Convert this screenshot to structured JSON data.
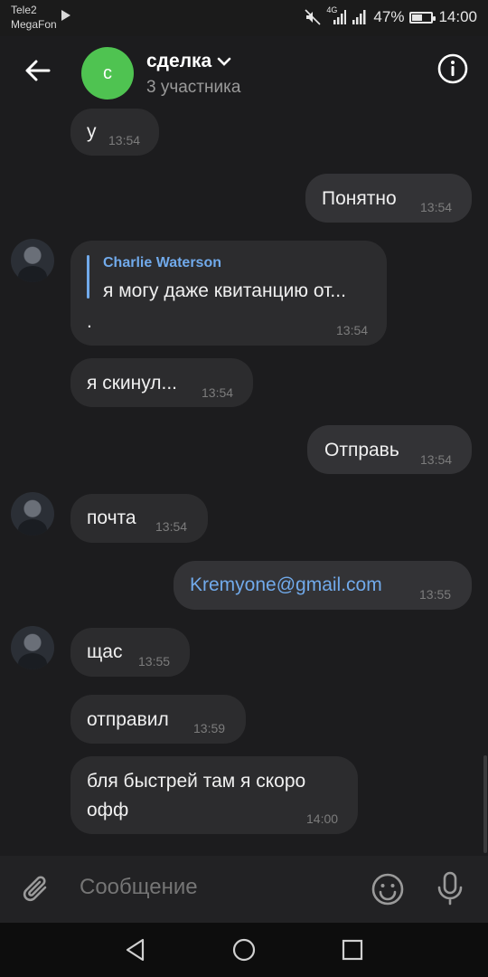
{
  "status_bar": {
    "carrier1": "Tele2",
    "carrier2": "MegaFon",
    "network": "4G",
    "battery_percent": "47%",
    "battery_level": 0.47,
    "clock": "14:00"
  },
  "header": {
    "avatar_letter": "с",
    "title": "сделка",
    "subtitle": "3 участника",
    "avatar_color": "#4fc351"
  },
  "messages": [
    {
      "dir": "in",
      "text": "у",
      "time": "13:54"
    },
    {
      "dir": "out",
      "text": "Понятно",
      "time": "13:54"
    },
    {
      "dir": "in",
      "reply_author": "Charlie Waterson",
      "text": "я могу даже квитанцию от...",
      "text2": ".",
      "time": "13:54"
    },
    {
      "dir": "in",
      "text": "я скинул...",
      "time": "13:54"
    },
    {
      "dir": "out",
      "text": "Отправь",
      "time": "13:54"
    },
    {
      "dir": "in",
      "text": "почта",
      "time": "13:54"
    },
    {
      "dir": "out",
      "text": "Kremyone@gmail.com",
      "time": "13:55",
      "is_link": true
    },
    {
      "dir": "in",
      "text": "щас",
      "time": "13:55"
    },
    {
      "dir": "in",
      "text": "отправил",
      "time": "13:59"
    },
    {
      "dir": "in",
      "text": "бля быстрей там я скоро",
      "text2": "офф",
      "time": "14:00"
    }
  ],
  "composer": {
    "placeholder": "Сообщение"
  },
  "colors": {
    "background": "#1c1c1e",
    "bubble": "#2c2c2e",
    "link": "#71aaeb"
  }
}
